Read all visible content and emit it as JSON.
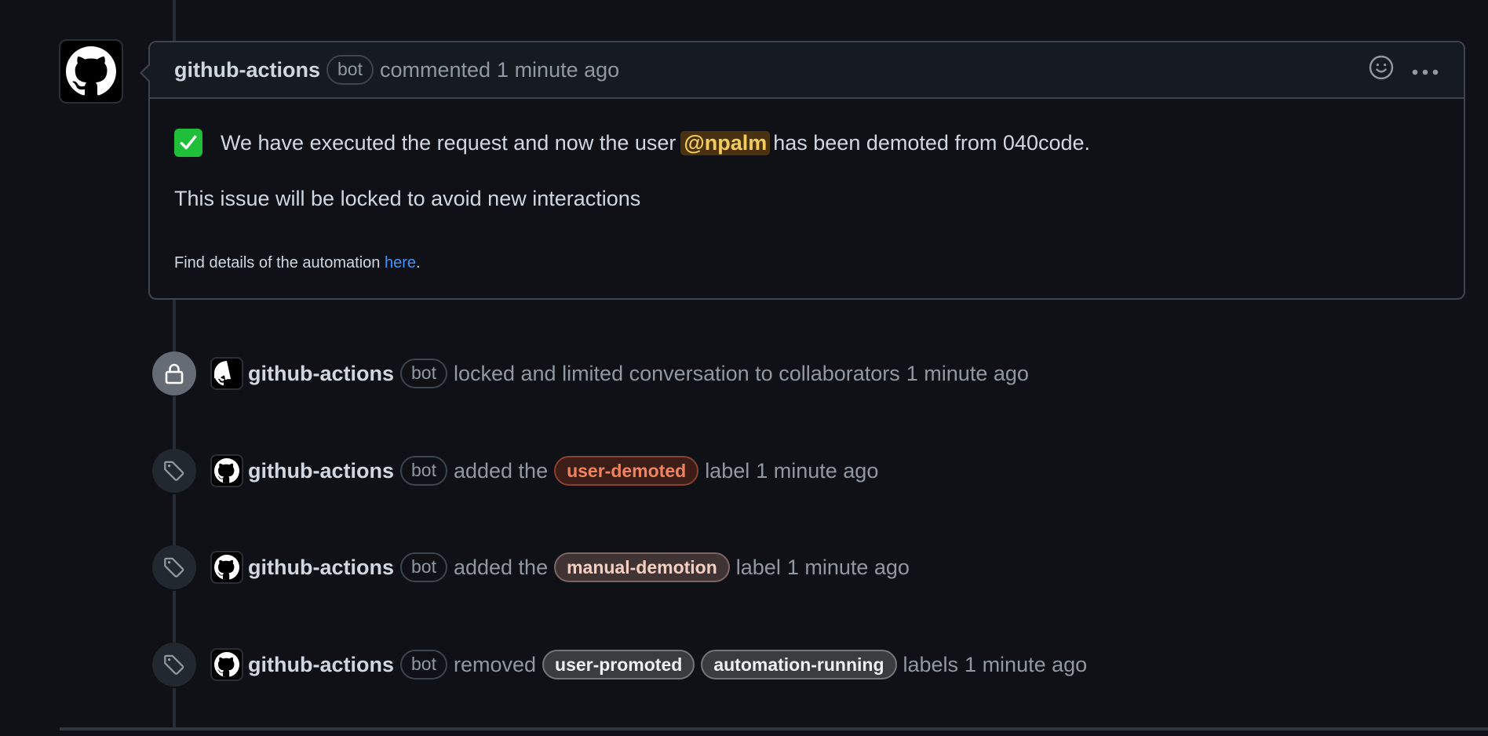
{
  "comment": {
    "author": "github-actions",
    "author_badge": "bot",
    "action": "commented",
    "timestamp": "1 minute ago",
    "icons": {
      "reaction": "smiley-icon",
      "more": "kebab-horizontal-icon"
    },
    "body": {
      "emoji": "white-check-mark-icon",
      "line1_prefix": "We have executed the request and now the user",
      "mention": "@npalm",
      "line1_suffix": "has been demoted from 040code.",
      "line2": "This issue will be locked to avoid new interactions",
      "footer_prefix": "Find details of the automation",
      "footer_link": "here",
      "footer_suffix": "."
    }
  },
  "events": [
    {
      "icon": "lock-icon",
      "author": "github-actions",
      "author_badge": "bot",
      "text_before": "locked and limited conversation to collaborators",
      "labels": [],
      "text_after": "",
      "timestamp": "1 minute ago"
    },
    {
      "icon": "tag-icon",
      "author": "github-actions",
      "author_badge": "bot",
      "text_before": "added the",
      "labels": [
        {
          "name": "user-demoted",
          "color": "#f0845f",
          "bg": "#3d1d18",
          "border": "#8a4230"
        }
      ],
      "text_after": "label",
      "timestamp": "1 minute ago"
    },
    {
      "icon": "tag-icon",
      "author": "github-actions",
      "author_badge": "bot",
      "text_before": "added the",
      "labels": [
        {
          "name": "manual-demotion",
          "color": "#f5cfc2",
          "bg": "#3f3433",
          "border": "#7b6663"
        }
      ],
      "text_after": "label",
      "timestamp": "1 minute ago"
    },
    {
      "icon": "tag-icon",
      "author": "github-actions",
      "author_badge": "bot",
      "text_before": "removed",
      "labels": [
        {
          "name": "user-promoted",
          "color": "#f0f0f0",
          "bg": "#3b3c3e",
          "border": "#727579"
        },
        {
          "name": "automation-running",
          "color": "#f0f0f0",
          "bg": "#3b3c3e",
          "border": "#727579"
        }
      ],
      "text_after": "labels",
      "timestamp": "1 minute ago"
    }
  ]
}
